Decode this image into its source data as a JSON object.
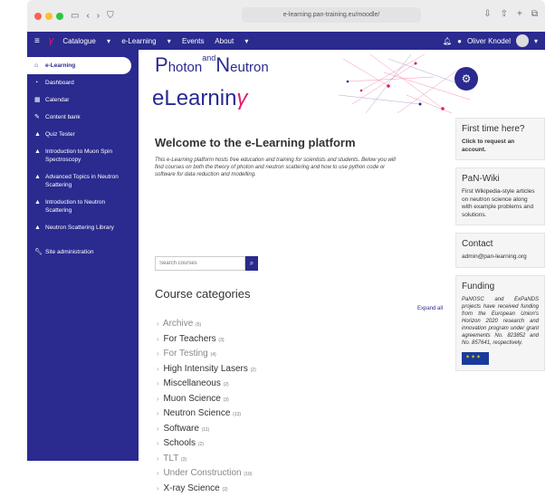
{
  "browser": {
    "url": "e-learning.pan-training.eu/moodle/"
  },
  "navbar": {
    "logo": "γ",
    "menu": [
      "Catalogue",
      "e-Learning",
      "Events",
      "About"
    ],
    "user_name": "Oliver Knodel"
  },
  "sidebar": {
    "items": [
      {
        "label": "e-Learning",
        "icon": "home-icon",
        "active": true
      },
      {
        "label": "Dashboard",
        "icon": "dashboard-icon"
      },
      {
        "label": "Calendar",
        "icon": "calendar-icon"
      },
      {
        "label": "Content bank",
        "icon": "pencil-icon"
      },
      {
        "label": "Quiz Tester",
        "icon": "graduation-cap-icon"
      },
      {
        "label": "Introduction to Muon Spin Spectroscopy",
        "icon": "graduation-cap-icon"
      },
      {
        "label": "Advanced Topics in Neutron Scattering",
        "icon": "graduation-cap-icon"
      },
      {
        "label": "Introduction to Neutron Scattering",
        "icon": "graduation-cap-icon"
      },
      {
        "label": "Neutron Scattering Library",
        "icon": "graduation-cap-icon"
      },
      {
        "label": "Site administration",
        "icon": "wrench-icon"
      }
    ]
  },
  "banner": {
    "logo_line1_a": "P",
    "logo_line1_b": "hoton",
    "logo_and": "and",
    "logo_line1_c": "N",
    "logo_line1_d": "eutron",
    "logo_line2": "eLearnin"
  },
  "main": {
    "welcome_title": "Welcome to the e-Learning platform",
    "intro": "This e-Learning platform hosts free education and training for scientists and students. Below you will find courses on both the theory of photon and neutron scattering and how to use python code or software for data reduction and modelling.",
    "search_placeholder": "Search courses",
    "categories_title": "Course categories",
    "expand_all": "Expand all",
    "categories": [
      {
        "name": "Archive",
        "count": "(5)",
        "dim": true
      },
      {
        "name": "For Teachers",
        "count": "(3)",
        "dim": false
      },
      {
        "name": "For Testing",
        "count": "(4)",
        "dim": true
      },
      {
        "name": "High Intensity Lasers",
        "count": "(2)",
        "dim": false
      },
      {
        "name": "Miscellaneous",
        "count": "(2)",
        "dim": false
      },
      {
        "name": "Muon Science",
        "count": "(3)",
        "dim": false
      },
      {
        "name": "Neutron Science",
        "count": "(13)",
        "dim": false
      },
      {
        "name": "Software",
        "count": "(11)",
        "dim": false
      },
      {
        "name": "Schools",
        "count": "(2)",
        "dim": false
      },
      {
        "name": "TLT",
        "count": "(3)",
        "dim": true
      },
      {
        "name": "Under Construction",
        "count": "(10)",
        "dim": true
      },
      {
        "name": "X-ray Science",
        "count": "(2)",
        "dim": false
      }
    ]
  },
  "right": {
    "first_time_title": "First time here?",
    "first_time_link": "Click to request an account.",
    "wiki_title": "PaN-Wiki",
    "wiki_text": "First Wikipedia-style articles on neutron science along with example problems and solutions.",
    "contact_title": "Contact",
    "contact_email": "admin@pan-learning.org",
    "funding_title": "Funding",
    "funding_text": "PaNOSC and ExPaNDS projects have received funding from the European Union's Horizon 2020 research and innovation program under grant agreements No. 823852 and No. 857641, respectively."
  }
}
